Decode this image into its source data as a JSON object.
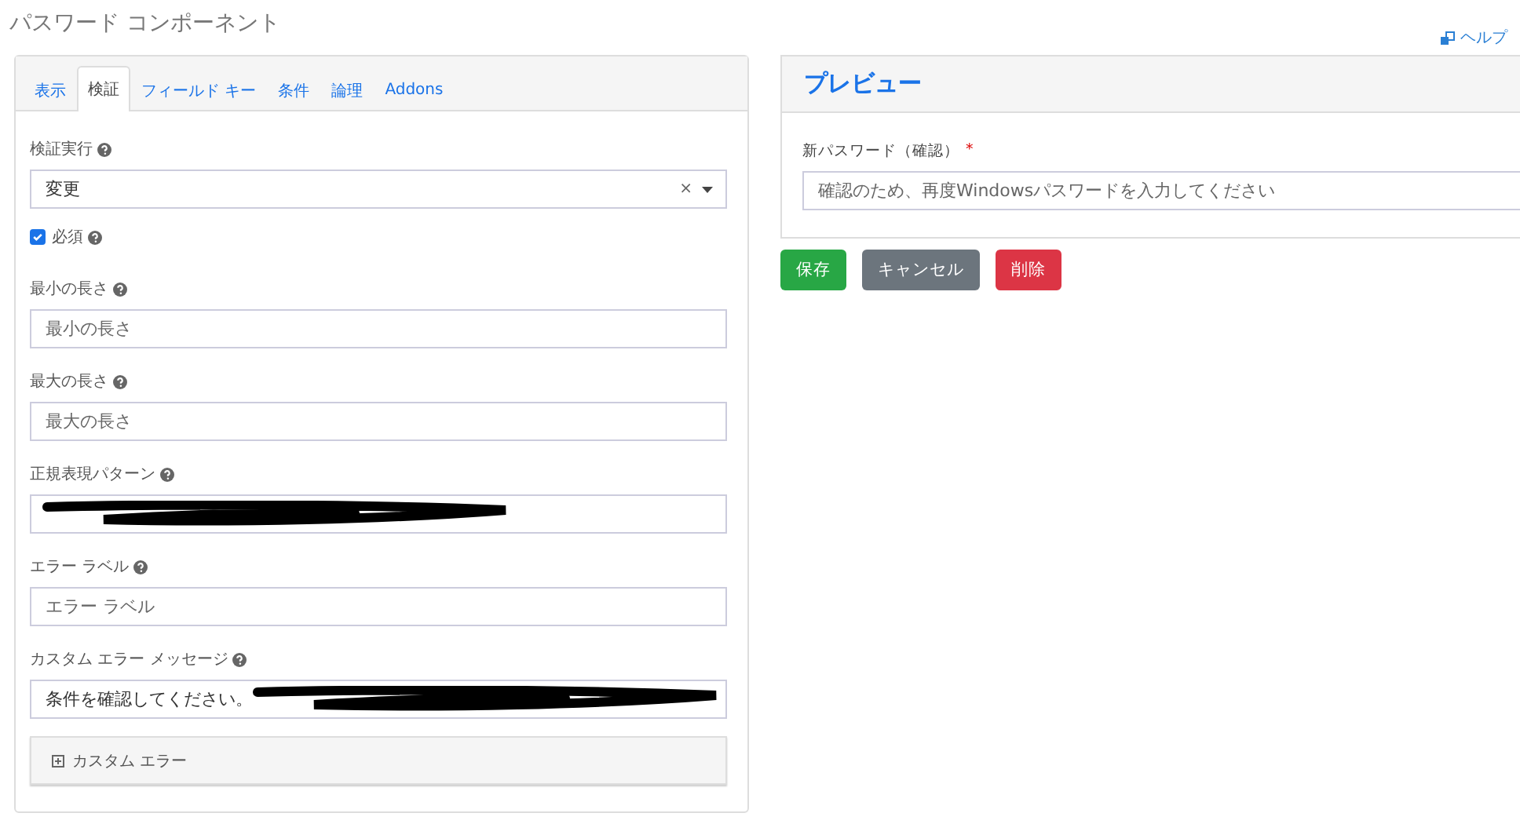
{
  "title": "パスワード コンポーネント",
  "help_link": "ヘルプ",
  "tabs": [
    {
      "label": "表示",
      "selected": false
    },
    {
      "label": "検証",
      "selected": true
    },
    {
      "label": "フィールド キー",
      "selected": false
    },
    {
      "label": "条件",
      "selected": false
    },
    {
      "label": "論理",
      "selected": false
    },
    {
      "label": "Addons",
      "selected": false
    }
  ],
  "fields": [
    {
      "kind": "select",
      "label": "検証実行",
      "value": "変更",
      "clear": "×"
    },
    {
      "kind": "checkbox",
      "label": "必須",
      "checked": true
    },
    {
      "kind": "text",
      "label": "最小の長さ",
      "placeholder": "最小の長さ"
    },
    {
      "kind": "text",
      "label": "最大の長さ",
      "placeholder": "最大の長さ"
    },
    {
      "kind": "text",
      "label": "正規表現パターン",
      "redacted": true
    },
    {
      "kind": "text",
      "label": "エラー ラベル",
      "placeholder": "エラー ラベル"
    },
    {
      "kind": "text",
      "label": "カスタム エラー メッセージ",
      "value": "条件を確認してください。",
      "redacted": true
    }
  ],
  "custom_error": {
    "label": "カスタム エラー",
    "expanded": false
  },
  "preview": {
    "title": "プレビュー",
    "field_label": "新パスワード（確認）",
    "required_mark": "*",
    "placeholder": "確認のため、再度Windowsパスワードを入力してください"
  },
  "buttons": [
    {
      "kind": "success",
      "label": "保存"
    },
    {
      "kind": "secondary",
      "label": "キャンセル"
    },
    {
      "kind": "danger",
      "label": "削除"
    }
  ]
}
